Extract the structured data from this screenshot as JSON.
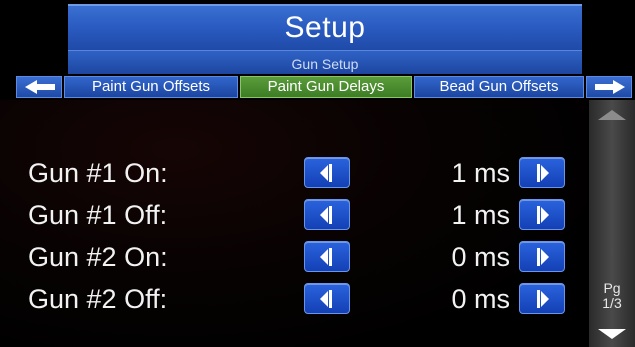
{
  "header": {
    "title": "Setup",
    "subtitle": "Gun Setup"
  },
  "tabs": [
    {
      "label": "Paint Gun Offsets",
      "active": false
    },
    {
      "label": "Paint Gun Delays",
      "active": true
    },
    {
      "label": "Bead Gun Offsets",
      "active": false
    }
  ],
  "rows": [
    {
      "label": "Gun #1 On:",
      "value": "1 ms"
    },
    {
      "label": "Gun #1 Off:",
      "value": "1 ms"
    },
    {
      "label": "Gun #2 On:",
      "value": "0 ms"
    },
    {
      "label": "Gun #2 Off:",
      "value": "0 ms"
    }
  ],
  "pager": {
    "label": "Pg",
    "page": "1/3"
  },
  "colors": {
    "header_blue": "#2b5cc2",
    "active_tab_green": "#4a8c2f",
    "button_blue": "#1f50c8",
    "rail_gray": "#3a3a3a"
  },
  "icons": {
    "tab_prev": "arrow-left-icon",
    "tab_next": "arrow-right-icon",
    "decrement": "chevron-left-icon",
    "increment": "chevron-right-icon",
    "scroll_up": "triangle-up-icon",
    "scroll_down": "triangle-down-icon"
  }
}
